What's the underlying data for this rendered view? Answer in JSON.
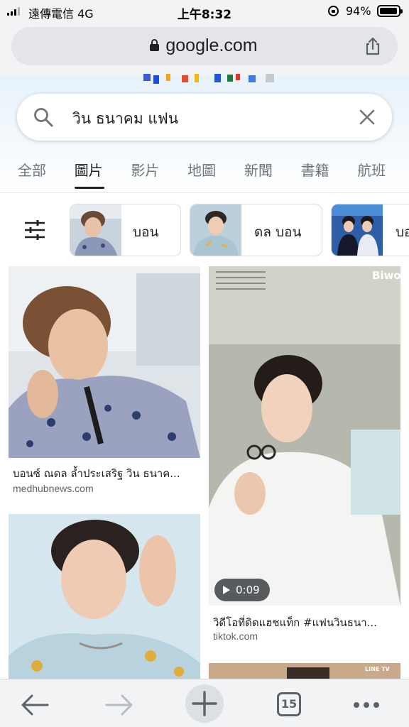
{
  "status_bar": {
    "carrier": "遠傳電信  4G",
    "time": "上午8:32",
    "battery": "94%",
    "battery_level": 0.94
  },
  "browser": {
    "url": "google.com"
  },
  "search": {
    "query": "วิน ธนาคม แฟน"
  },
  "tabs": [
    {
      "label": "全部"
    },
    {
      "label": "圖片",
      "active": true
    },
    {
      "label": "影片"
    },
    {
      "label": "地圖"
    },
    {
      "label": "新聞"
    },
    {
      "label": "書籍"
    },
    {
      "label": "航班"
    }
  ],
  "chips": [
    {
      "label": "บอน"
    },
    {
      "label": "ดล บอน"
    },
    {
      "label": "บอ"
    }
  ],
  "results": [
    {
      "title": "บอนซ์ ณดล ล้ำประเสริฐ วิน ธนาค...",
      "source": "medhubnews.com"
    },
    {
      "title": "วิดีโอที่ดิดแฮชแท็ก #แฟนวินธนา...",
      "source": "tiktok.com",
      "duration": "0:09",
      "watermark": "Biwo"
    },
    {
      "title": "",
      "source": ""
    },
    {
      "title": "",
      "source": "",
      "watermark": "LINE TV"
    }
  ],
  "toolbar": {
    "tab_count": "15"
  },
  "colors": {
    "text": "#202124",
    "muted": "#70757a",
    "toolbar_bg": "#f1f3f4"
  }
}
